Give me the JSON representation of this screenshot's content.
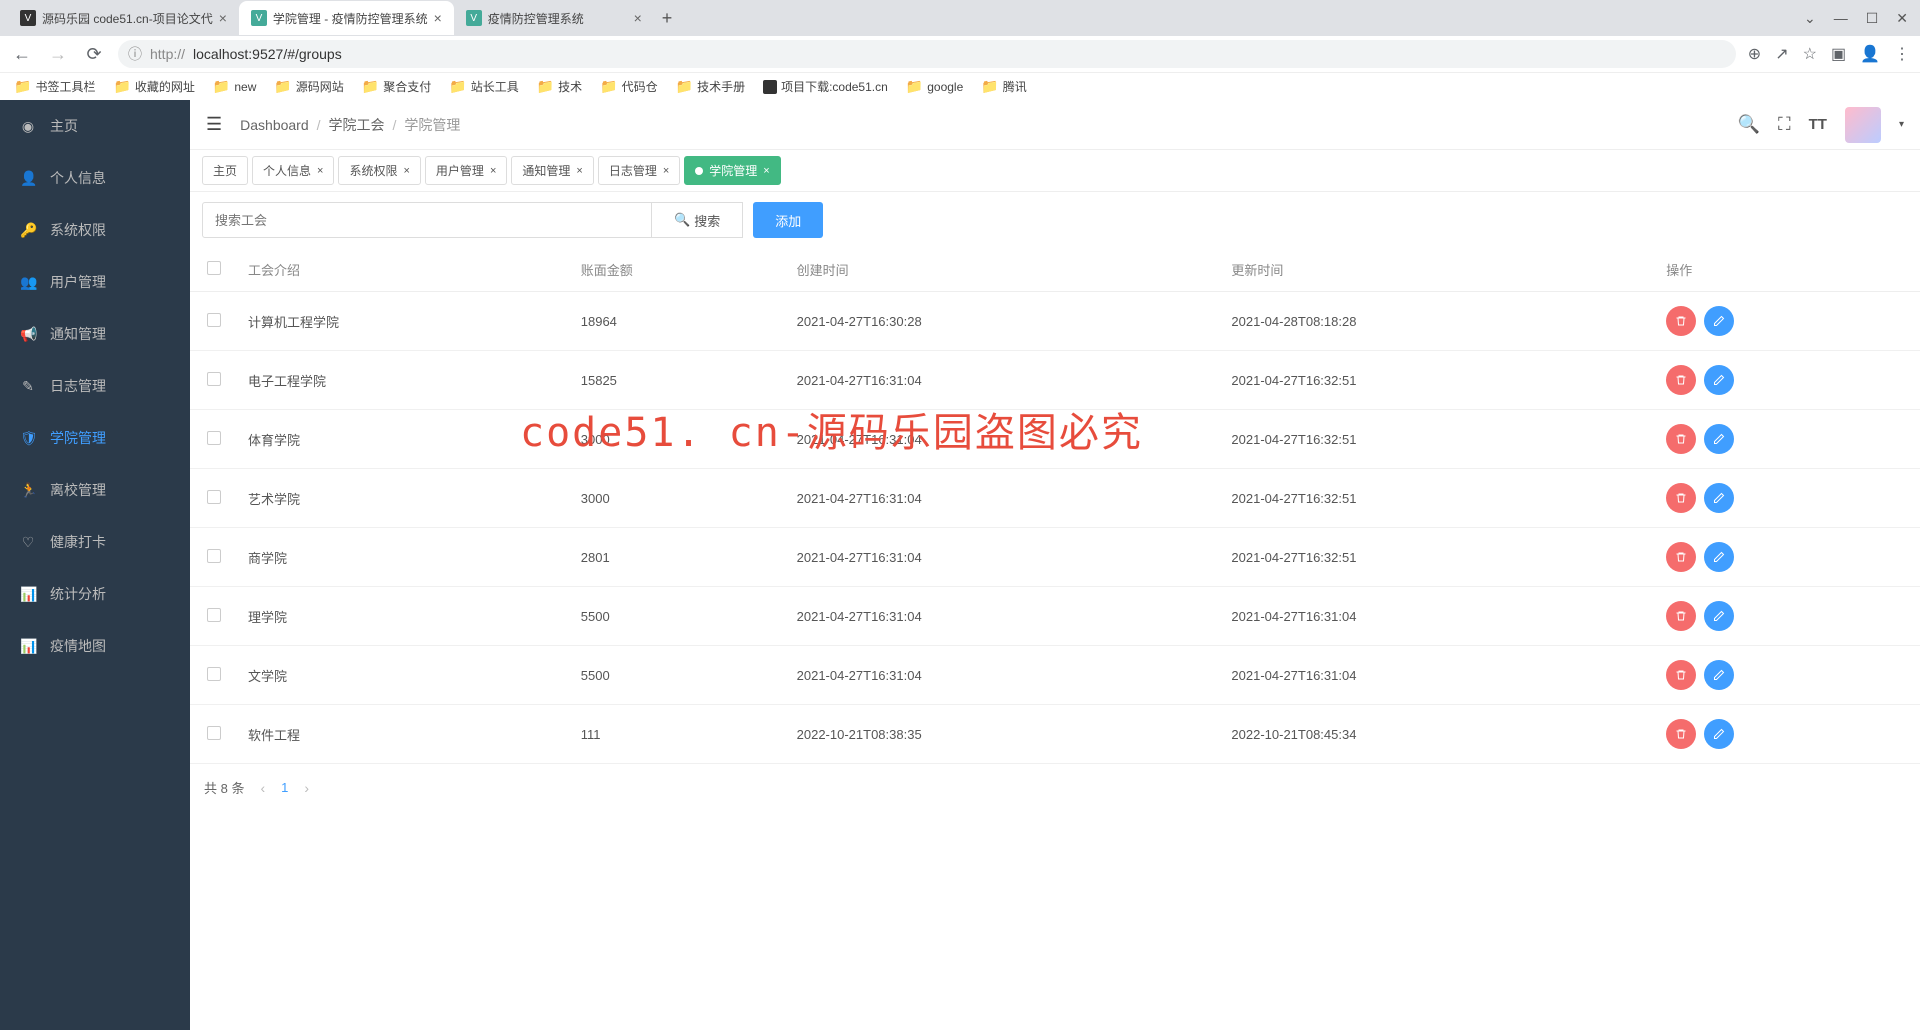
{
  "browser": {
    "tabs": [
      {
        "title": "源码乐园 code51.cn-项目论文代",
        "active": false,
        "faviconDark": true
      },
      {
        "title": "学院管理 - 疫情防控管理系统",
        "active": true,
        "faviconDark": false
      },
      {
        "title": "疫情防控管理系统",
        "active": false,
        "faviconDark": false
      }
    ],
    "url": "http://localhost:9527/#/groups",
    "url_proto": "http://",
    "url_rest": "localhost:9527/#/groups",
    "bookmarks": [
      "书签工具栏",
      "收藏的网址",
      "new",
      "源码网站",
      "聚合支付",
      "站长工具",
      "技术",
      "代码仓",
      "技术手册",
      "项目下载:code51.cn",
      "google",
      "腾讯"
    ]
  },
  "sidebar": {
    "items": [
      {
        "label": "主页",
        "icon": "◉"
      },
      {
        "label": "个人信息",
        "icon": "👤"
      },
      {
        "label": "系统权限",
        "icon": "🔑"
      },
      {
        "label": "用户管理",
        "icon": "👥"
      },
      {
        "label": "通知管理",
        "icon": "📢"
      },
      {
        "label": "日志管理",
        "icon": "✎"
      },
      {
        "label": "学院管理",
        "icon": "🛡"
      },
      {
        "label": "离校管理",
        "icon": "🏃"
      },
      {
        "label": "健康打卡",
        "icon": "♡"
      },
      {
        "label": "统计分析",
        "icon": "📊"
      },
      {
        "label": "疫情地图",
        "icon": "📊"
      }
    ],
    "activeIndex": 6
  },
  "breadcrumb": {
    "items": [
      "Dashboard",
      "学院工会",
      "学院管理"
    ]
  },
  "pageTabs": [
    {
      "label": "主页",
      "closable": false
    },
    {
      "label": "个人信息",
      "closable": true
    },
    {
      "label": "系统权限",
      "closable": true
    },
    {
      "label": "用户管理",
      "closable": true
    },
    {
      "label": "通知管理",
      "closable": true
    },
    {
      "label": "日志管理",
      "closable": true
    },
    {
      "label": "学院管理",
      "closable": true,
      "active": true
    }
  ],
  "search": {
    "placeholder": "搜索工会",
    "button": "搜索",
    "add": "添加"
  },
  "table": {
    "headers": [
      "工会介绍",
      "账面金额",
      "创建时间",
      "更新时间",
      "操作"
    ],
    "rows": [
      {
        "name": "计算机工程学院",
        "amount": "18964",
        "created": "2021-04-27T16:30:28",
        "updated": "2021-04-28T08:18:28"
      },
      {
        "name": "电子工程学院",
        "amount": "15825",
        "created": "2021-04-27T16:31:04",
        "updated": "2021-04-27T16:32:51"
      },
      {
        "name": "体育学院",
        "amount": "3000",
        "created": "2021-04-27T16:31:04",
        "updated": "2021-04-27T16:32:51"
      },
      {
        "name": "艺术学院",
        "amount": "3000",
        "created": "2021-04-27T16:31:04",
        "updated": "2021-04-27T16:32:51"
      },
      {
        "name": "商学院",
        "amount": "2801",
        "created": "2021-04-27T16:31:04",
        "updated": "2021-04-27T16:32:51"
      },
      {
        "name": "理学院",
        "amount": "5500",
        "created": "2021-04-27T16:31:04",
        "updated": "2021-04-27T16:31:04"
      },
      {
        "name": "文学院",
        "amount": "5500",
        "created": "2021-04-27T16:31:04",
        "updated": "2021-04-27T16:31:04"
      },
      {
        "name": "软件工程",
        "amount": "111",
        "created": "2022-10-21T08:38:35",
        "updated": "2022-10-21T08:45:34"
      }
    ]
  },
  "pagination": {
    "total": "共 8 条",
    "current": "1"
  },
  "watermark": "code51. cn-源码乐园盗图必究"
}
